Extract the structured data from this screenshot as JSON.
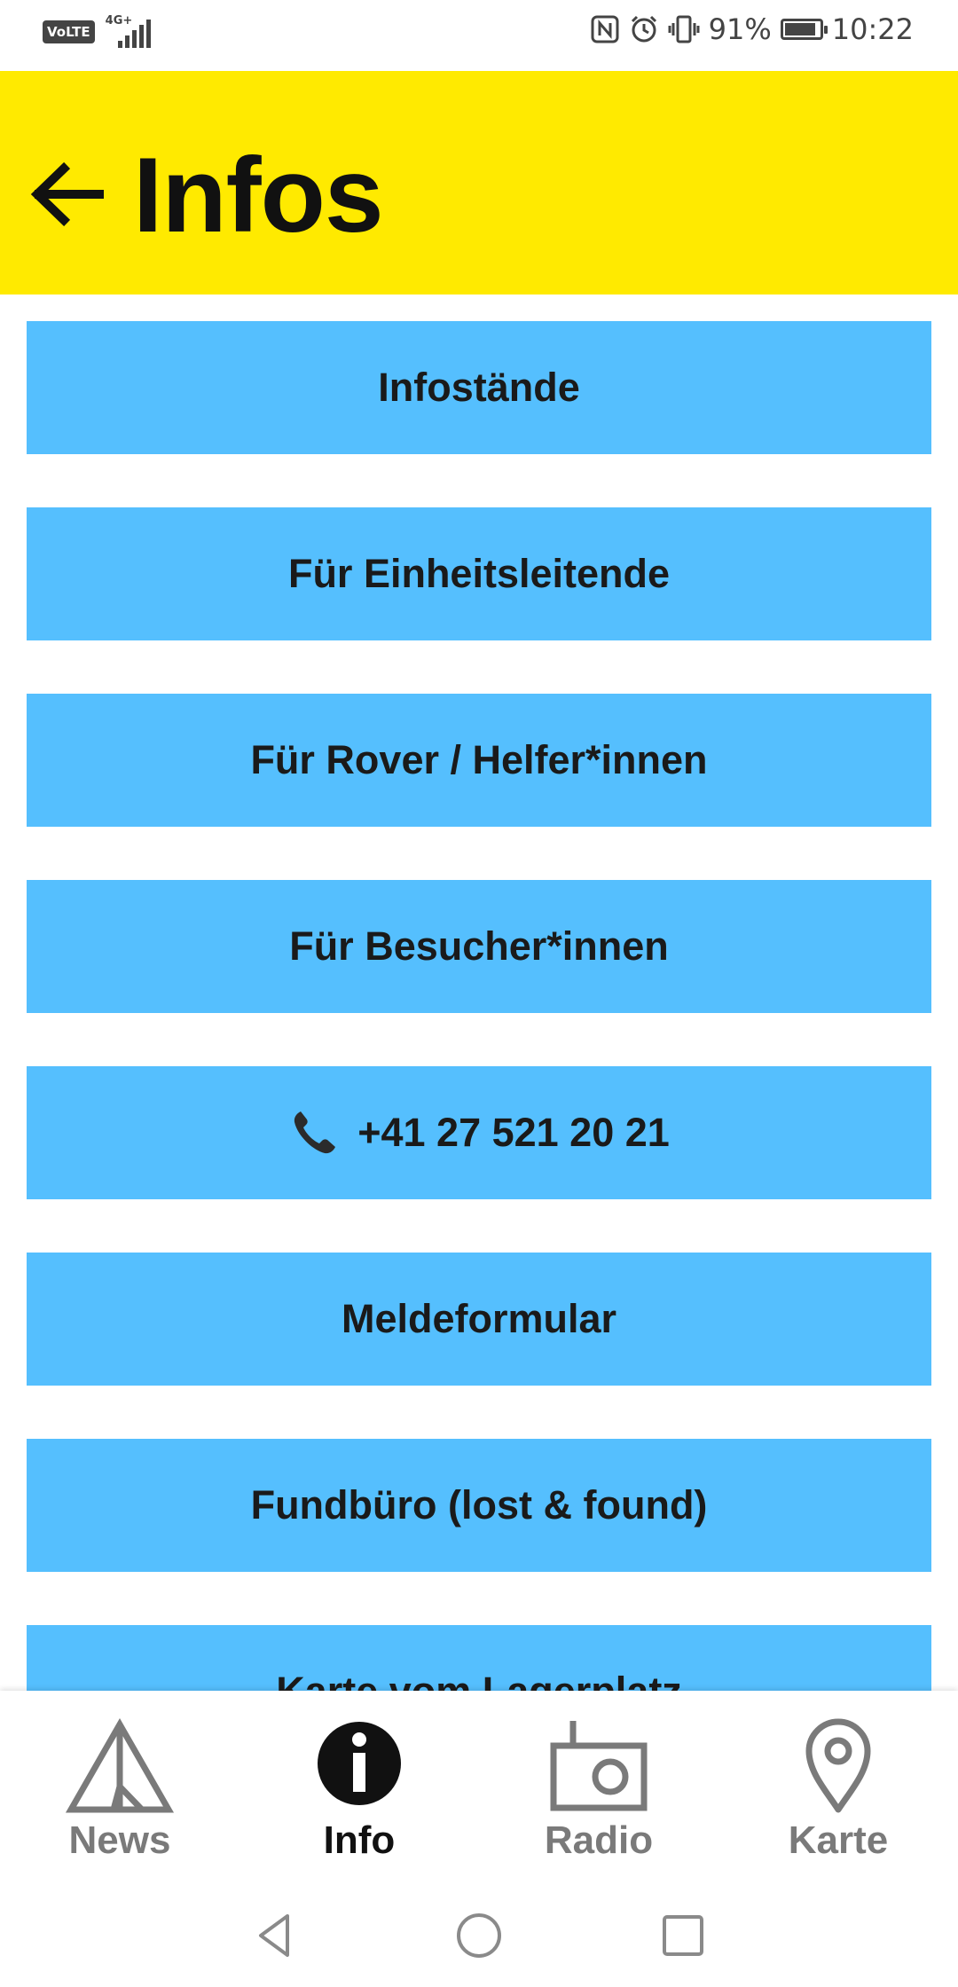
{
  "status_bar": {
    "volte": "VoLTE",
    "network": "4G+",
    "battery_percent_text": "91%",
    "battery_level": 0.91,
    "time": "10:22"
  },
  "header": {
    "title": "Infos",
    "background_color": "#ffea00"
  },
  "menu": {
    "button_color": "#55bffe",
    "items": [
      {
        "label": "Infostände"
      },
      {
        "label": "Für Einheitsleitende"
      },
      {
        "label": "Für Rover / Helfer*innen"
      },
      {
        "label": "Für Besucher*innen"
      },
      {
        "label": "+41 27 521 20 21",
        "icon": "phone-icon"
      },
      {
        "label": "Meldeformular"
      },
      {
        "label": "Fundbüro (lost & found)"
      },
      {
        "label": "Karte vom Lagerplatz"
      }
    ]
  },
  "bottom_nav": {
    "items": [
      {
        "label": "News",
        "icon": "tent-icon",
        "active": false
      },
      {
        "label": "Info",
        "icon": "info-icon",
        "active": true
      },
      {
        "label": "Radio",
        "icon": "radio-icon",
        "active": false
      },
      {
        "label": "Karte",
        "icon": "map-pin-icon",
        "active": false
      }
    ]
  },
  "system_nav": {
    "icons": [
      "back-icon",
      "home-icon",
      "recents-icon"
    ]
  }
}
